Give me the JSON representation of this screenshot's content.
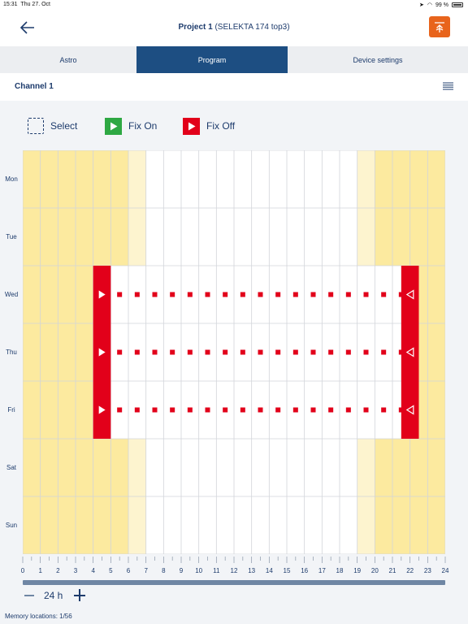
{
  "status_bar": {
    "time": "15:31",
    "date": "Thu 27. Oct",
    "battery": "99 %"
  },
  "header": {
    "project_name": "Project 1",
    "device": "(SELEKTA 174 top3)"
  },
  "tabs": [
    {
      "label": "Astro",
      "active": false
    },
    {
      "label": "Program",
      "active": true
    },
    {
      "label": "Device settings",
      "active": false
    }
  ],
  "channel": {
    "label": "Channel 1"
  },
  "legend": {
    "select": "Select",
    "fix_on": "Fix On",
    "fix_off": "Fix Off"
  },
  "colors": {
    "night": "#fcea9f",
    "twilight": "#fdf4cf",
    "day": "#ffffff",
    "switch": "#e2001a",
    "fix_on": "#2ea843",
    "accent": "#e8641c",
    "brand": "#1d4e82"
  },
  "schedule": {
    "days": [
      "Mon",
      "Tue",
      "Wed",
      "Thu",
      "Fri",
      "Sat",
      "Sun"
    ],
    "hours": [
      "0",
      "1",
      "2",
      "3",
      "4",
      "5",
      "6",
      "7",
      "8",
      "9",
      "10",
      "11",
      "12",
      "13",
      "14",
      "15",
      "16",
      "17",
      "18",
      "19",
      "20",
      "21",
      "22",
      "23",
      "24"
    ],
    "astro_night": {
      "morning_end_hour": 6,
      "twilight_end_hour": 7,
      "evening_twilight_start_hour": 19,
      "evening_start_hour": 20
    },
    "program_days": [
      "Wed",
      "Thu",
      "Fri"
    ],
    "switch_on_hour": 4,
    "switch_off_hour": 21.5
  },
  "zoom": {
    "value": "24 h"
  },
  "memory": "Memory locations: 1/56"
}
